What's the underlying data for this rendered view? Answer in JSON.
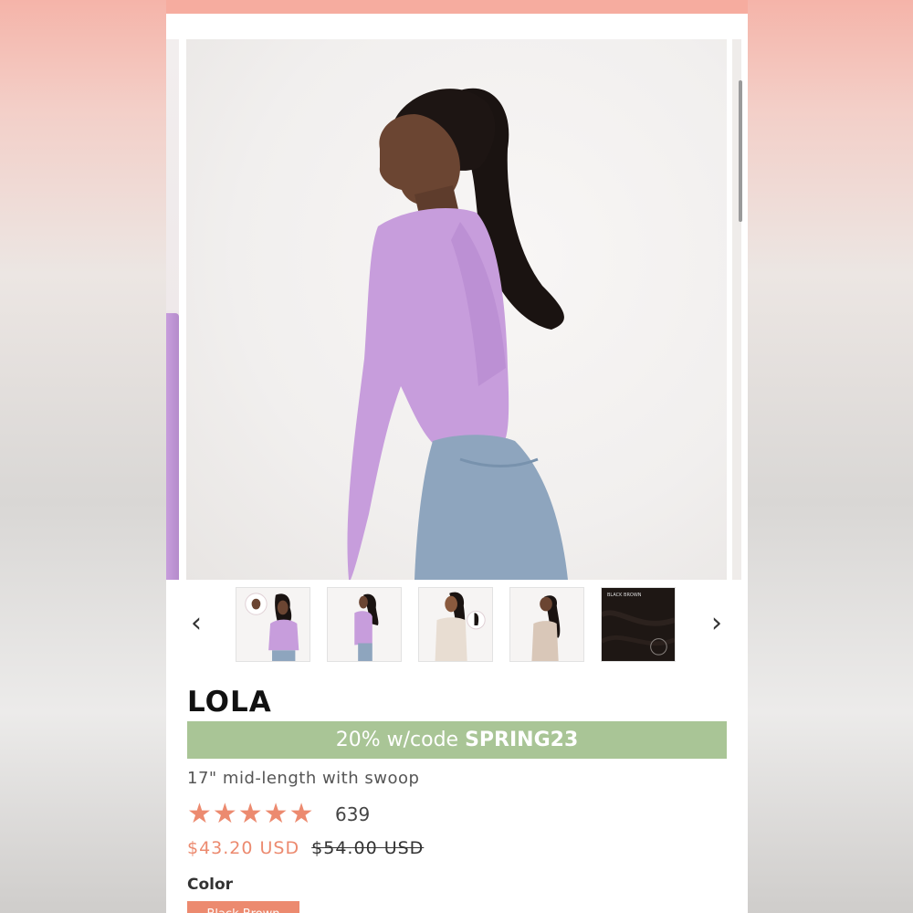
{
  "gallery": {
    "prev_label": "‹",
    "next_label": "›",
    "thumbnails": [
      {
        "alt": "Model in lilac top, front view"
      },
      {
        "alt": "Model in lilac top, side view"
      },
      {
        "alt": "Model in white top"
      },
      {
        "alt": "Model back view"
      },
      {
        "alt": "Black Brown color swatch",
        "swatch_text": "BLACK BROWN"
      }
    ]
  },
  "product": {
    "title": "LOLA",
    "promo_text": "20% w/code ",
    "promo_code": "SPRING23",
    "subtitle": "17\" mid-length with swoop",
    "rating_stars": "★★★★★",
    "rating_value": 5,
    "review_count": "639",
    "sale_price": "$43.20 USD",
    "compare_price": "$54.00 USD",
    "color_label": "Color",
    "selected_color": "Black Brown"
  },
  "colors": {
    "banner": "#f6ac9f",
    "promo": "#a9c596",
    "accent": "#ec8a6f",
    "top": "#c79ddc",
    "hair": "#1a1311"
  }
}
